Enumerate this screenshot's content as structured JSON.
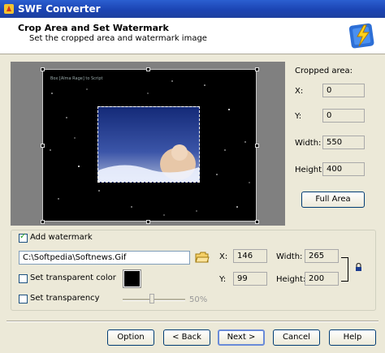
{
  "window": {
    "title": "SWF Converter"
  },
  "header": {
    "title": "Crop Area and Set Watermark",
    "subtitle": "Set the cropped area and watermark image"
  },
  "preview": {
    "watermark_text": "Box [Alma Rage] to Script"
  },
  "crop": {
    "section_label": "Cropped area:",
    "x_label": "X:",
    "x_value": "0",
    "y_label": "Y:",
    "y_value": "0",
    "width_label": "Width:",
    "width_value": "550",
    "height_label": "Height:",
    "height_value": "400",
    "full_area_label": "Full Area"
  },
  "watermark": {
    "add_label": "Add watermark",
    "add_checked": true,
    "file_path": "C:\\Softpedia\\Softnews.Gif",
    "x_label": "X:",
    "x_value": "146",
    "y_label": "Y:",
    "y_value": "99",
    "width_label": "Width:",
    "width_value": "265",
    "height_label": "Height:",
    "height_value": "200",
    "transparent_color_label": "Set transparent color",
    "transparent_color": "#000000",
    "transparency_label": "Set transparency",
    "transparency_value": "50%"
  },
  "footer": {
    "option": "Option",
    "back": "< Back",
    "next": "Next >",
    "cancel": "Cancel",
    "help": "Help"
  }
}
